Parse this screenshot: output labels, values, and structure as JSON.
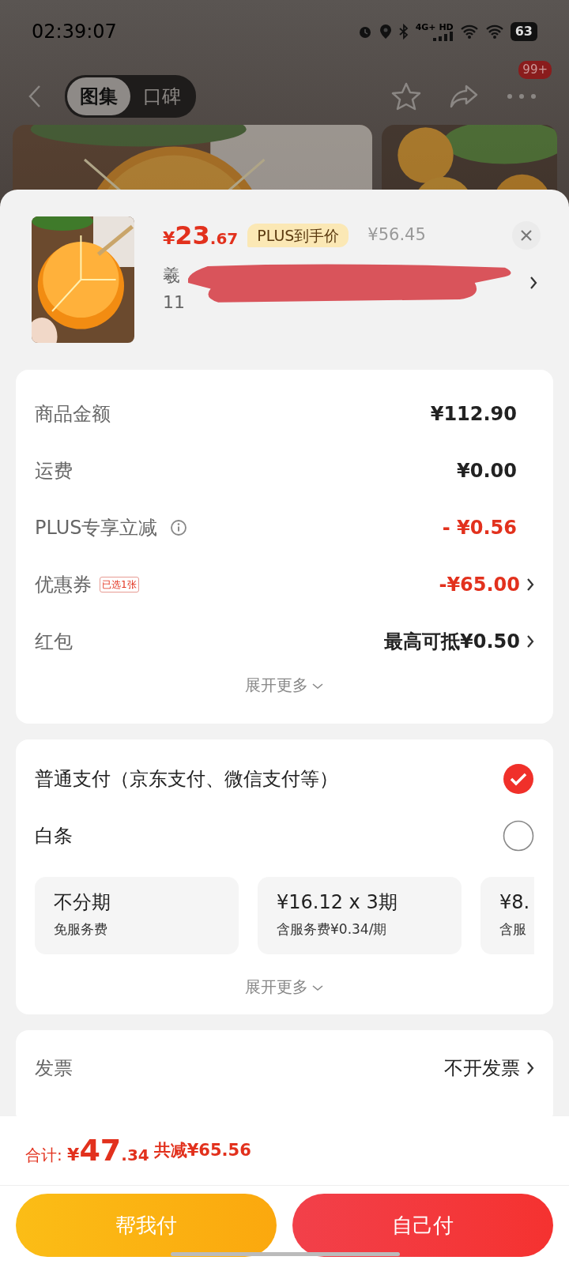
{
  "status_bar": {
    "time": "02:39:07",
    "network": "4G+ HD",
    "battery": "63"
  },
  "header": {
    "tabs": [
      {
        "label": "图集",
        "selected": true
      },
      {
        "label": "口碑",
        "selected": false
      }
    ],
    "badge": "99+"
  },
  "product": {
    "price_symbol": "¥",
    "price_int": "23",
    "price_dec": ".67",
    "plus_tag": "PLUS到手价",
    "original_price": "¥56.45",
    "title_line1": "羲",
    "title_line2": "11"
  },
  "summary": {
    "rows": [
      {
        "label": "商品金额",
        "value": "¥112.90",
        "kind": "plain"
      },
      {
        "label": "运费",
        "value": "¥0.00",
        "kind": "plain"
      },
      {
        "label": "PLUS专享立减",
        "value": "- ¥0.56",
        "kind": "info_discount"
      },
      {
        "label": "优惠券",
        "tag": "已选1张",
        "value": "-¥65.00",
        "kind": "link_discount"
      },
      {
        "label": "红包",
        "value": "最高可抵¥0.50",
        "kind": "link"
      }
    ],
    "expand": "展开更多"
  },
  "payment": {
    "methods": [
      {
        "label": "普通支付（京东支付、微信支付等）",
        "selected": true
      },
      {
        "label": "白条",
        "selected": false
      }
    ],
    "installments": [
      {
        "title": "不分期",
        "sub": "免服务费"
      },
      {
        "title": "¥16.12 x 3期",
        "sub": "含服务费¥0.34/期"
      },
      {
        "title": "¥8.",
        "sub": "含服"
      }
    ],
    "expand": "展开更多"
  },
  "invoice": {
    "label": "发票",
    "value": "不开发票"
  },
  "footer": {
    "total_label": "合计: ",
    "total_symbol": "¥",
    "total_int": "47",
    "total_dec": ".34",
    "saved": "共减¥65.56",
    "buttons": [
      {
        "label": "帮我付",
        "kind": "secondary"
      },
      {
        "label": "自己付",
        "kind": "primary"
      }
    ]
  }
}
